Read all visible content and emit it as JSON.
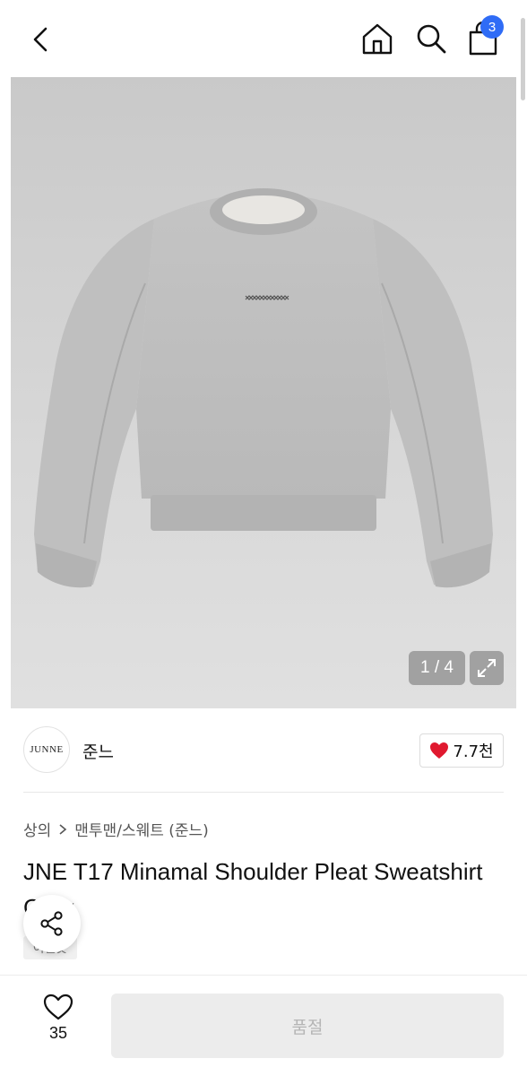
{
  "header": {
    "back_icon": "chevron-left-icon",
    "home_icon": "home-icon",
    "search_icon": "search-icon",
    "cart_icon": "shopping-bag-icon",
    "cart_count": "3",
    "badge_color": "#2f6cf6"
  },
  "gallery": {
    "counter": "1 / 4",
    "expand_icon": "expand-icon",
    "background": "#d2d2d2"
  },
  "brand": {
    "logo_text": "JUNNE",
    "name": "준느",
    "like_count": "7.7천",
    "heart_color": "#e0192f"
  },
  "breadcrumb": {
    "category": "상의",
    "subcategory": "맨투맨/스웨트 (준느)"
  },
  "product": {
    "title": "JNE T17 Minamal Shoulder Pleat Sweatshirt Grey",
    "tag": "이월곳"
  },
  "bottom_bar": {
    "wish_count": "35",
    "soldout_label": "품절"
  }
}
